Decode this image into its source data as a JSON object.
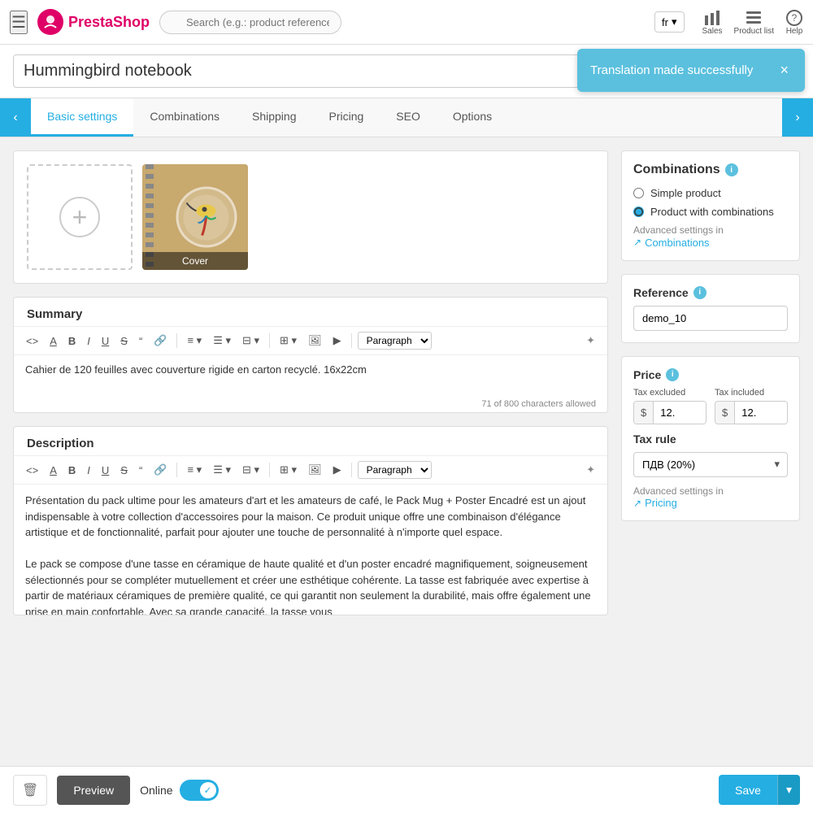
{
  "app": {
    "name": "PrestaShop",
    "logo_letter": "P"
  },
  "topnav": {
    "search_placeholder": "Search (e.g.: product reference, custon",
    "lang": "fr",
    "sales_label": "Sales",
    "product_list_label": "Product list",
    "help_label": "Help"
  },
  "toast": {
    "message": "Translation made successfully",
    "close_label": "×"
  },
  "product": {
    "title": "Hummingbird notebook",
    "type": "Standard"
  },
  "tabs": [
    {
      "id": "basic-settings",
      "label": "Basic settings",
      "active": true
    },
    {
      "id": "combinations",
      "label": "Combinations",
      "active": false
    },
    {
      "id": "shipping",
      "label": "Shipping",
      "active": false
    },
    {
      "id": "pricing",
      "label": "Pricing",
      "active": false
    },
    {
      "id": "seo",
      "label": "SEO",
      "active": false
    },
    {
      "id": "options",
      "label": "Options",
      "active": false
    }
  ],
  "image_section": {
    "cover_label": "Cover"
  },
  "summary": {
    "label": "Summary",
    "content": "Cahier de 120 feuilles avec couverture rigide en carton recyclé. 16x22cm",
    "char_count": "71 of 800 characters allowed",
    "paragraph_label": "Paragraph"
  },
  "description": {
    "label": "Description",
    "content_p1": "Présentation du pack ultime pour les amateurs d'art et les amateurs de café, le Pack Mug + Poster Encadré est un ajout indispensable à votre collection d'accessoires pour la maison. Ce produit unique offre une combinaison d'élégance artistique et de fonctionnalité, parfait pour ajouter une touche de personnalité à n'importe quel espace.",
    "content_p2": "Le pack se compose d'une tasse en céramique de haute qualité et d'un poster encadré magnifiquement, soigneusement sélectionnés pour se compléter mutuellement et créer une esthétique cohérente. La tasse est fabriquée avec expertise à partir de matériaux céramiques de première qualité, ce qui garantit non seulement la durabilité, mais offre également une prise en main confortable. Avec sa grande capacité, la tasse vous",
    "paragraph_label": "Paragraph"
  },
  "combinations_panel": {
    "title": "Combinations",
    "simple_label": "Simple product",
    "with_combinations_label": "Product with combinations",
    "advanced_settings_text": "Advanced settings in",
    "combinations_link": "Combinations"
  },
  "reference_panel": {
    "title": "Reference",
    "value": "demo_10"
  },
  "price_panel": {
    "title": "Price",
    "tax_excluded_label": "Tax excluded",
    "tax_included_label": "Tax included",
    "currency": "$",
    "tax_excluded_value": "12.",
    "tax_included_value": "12.",
    "tax_rule_label": "Tax rule",
    "tax_rule_value": "ПДВ (20%)",
    "advanced_settings_text": "Advanced settings in",
    "pricing_link": "Pricing"
  },
  "footer": {
    "preview_label": "Preview",
    "online_label": "Online",
    "save_label": "Save"
  },
  "toolbar": {
    "code": "<>",
    "bold": "B",
    "italic": "I",
    "underline": "U",
    "strikethrough": "S",
    "quote": "❝",
    "link": "🔗",
    "align": "≡",
    "bullets": "•≡",
    "numbered": "1≡",
    "table": "⊞",
    "image": "🖼",
    "video": "▶",
    "ai": "✦"
  }
}
